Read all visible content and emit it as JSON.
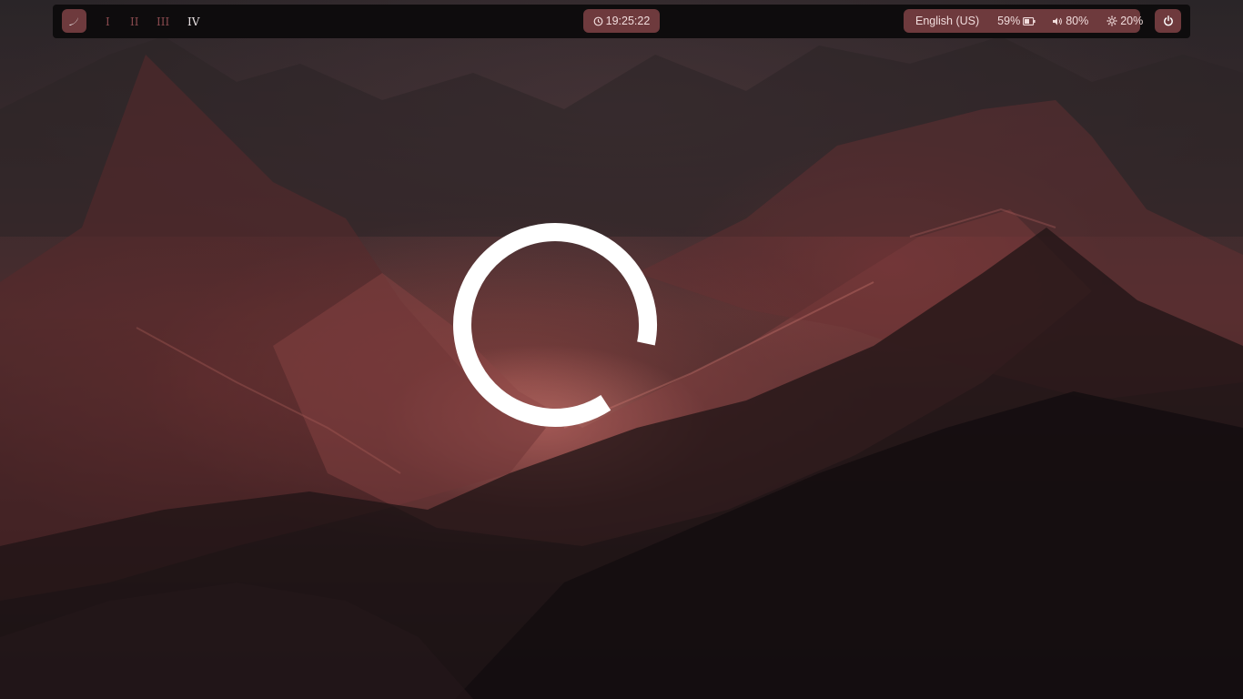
{
  "topbar": {
    "launcher_icon": "crescent-logo-icon",
    "workspaces": [
      {
        "label": "I",
        "active": false
      },
      {
        "label": "II",
        "active": false
      },
      {
        "label": "III",
        "active": false
      },
      {
        "label": "IV",
        "active": true
      }
    ],
    "clock": {
      "icon": "clock-icon",
      "time": "19:25:22"
    },
    "status": {
      "keyboard_layout": "English (US)",
      "battery_percent": "59%",
      "battery_icon": "battery-icon",
      "volume_icon": "speaker-icon",
      "volume_percent": "80%",
      "brightness_icon": "gear-brightness-icon",
      "brightness_percent": "20%"
    },
    "power_icon": "power-icon"
  },
  "colors": {
    "bar_background": "#0e0c0d",
    "pill_background": "#6e3a3d",
    "pill_text": "#f1dcdc",
    "inactive_workspace": "#8a4b4f",
    "active_workspace": "#e9e2e3",
    "ring": "#ffffff"
  },
  "desktop": {
    "wallpaper": "red-mountain-landscape",
    "center_logo": "open-ring-logo"
  }
}
